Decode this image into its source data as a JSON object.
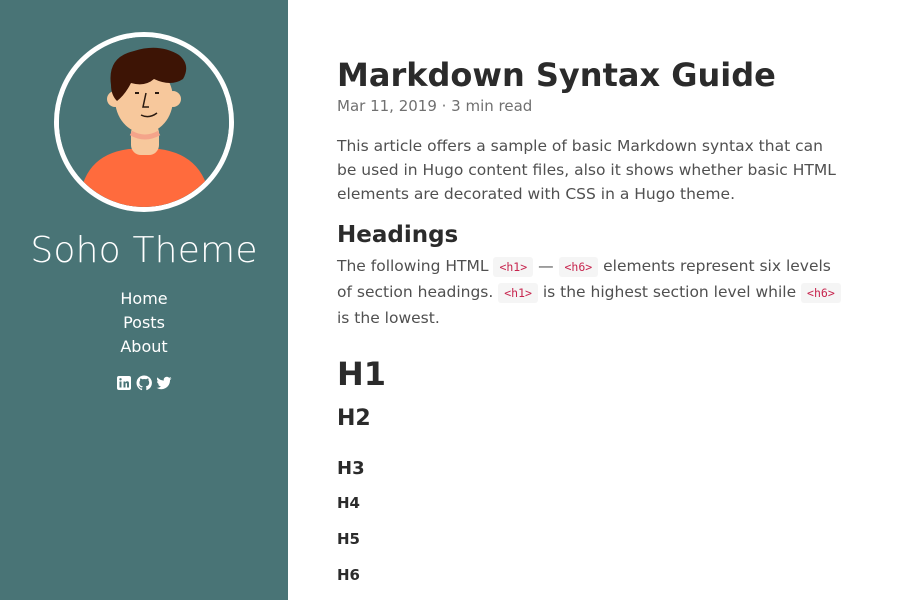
{
  "sidebar": {
    "site_title": "Soho Theme",
    "nav": [
      {
        "label": "Home"
      },
      {
        "label": "Posts"
      },
      {
        "label": "About"
      }
    ],
    "social_icons": [
      "linkedin-icon",
      "github-icon",
      "twitter-icon"
    ],
    "colors": {
      "background": "#497476",
      "text": "#ffffff"
    }
  },
  "post": {
    "title": "Markdown Syntax Guide",
    "meta": "Mar 11, 2019 · 3 min read",
    "intro": "This article offers a sample of basic Markdown syntax that can be used in Hugo content files, also it shows whether basic HTML elements are decorated with CSS in a Hugo theme.",
    "section_heading": "Headings",
    "para": {
      "t1": "The following HTML ",
      "c1": "<h1>",
      "t2": " — ",
      "c2": "<h6>",
      "t3": " elements represent six levels of section headings. ",
      "c3": "<h1>",
      "t4": " is the highest section level while ",
      "c4": "<h6>",
      "t5": " is the lowest."
    },
    "demo_headings": {
      "h1": "H1",
      "h2": "H2",
      "h3": "H3",
      "h4": "H4",
      "h5": "H5",
      "h6": "H6"
    },
    "colors": {
      "code_text": "#c7254e",
      "code_bg": "#f5f5f5"
    }
  }
}
